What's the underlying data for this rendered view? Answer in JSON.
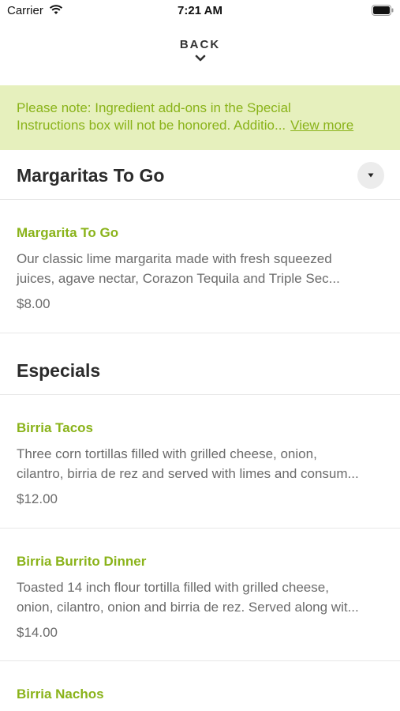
{
  "status_bar": {
    "carrier": "Carrier",
    "time": "7:21 AM"
  },
  "nav": {
    "back_label": "BACK"
  },
  "notice": {
    "line1": "Please note: Ingredient add-ons in the Special",
    "line2": "Instructions box will not be honored. Additio...",
    "link": "View more"
  },
  "sections": [
    {
      "title": "Margaritas To Go",
      "items": [
        {
          "name": "Margarita To Go",
          "desc1": "Our classic lime margarita made with fresh squeezed",
          "desc2": "juices, agave nectar, Corazon Tequila and Triple Sec...",
          "price": "$8.00"
        }
      ]
    },
    {
      "title": "Especials",
      "items": [
        {
          "name": "Birria Tacos",
          "desc1": "Three corn tortillas filled with grilled cheese, onion,",
          "desc2": "cilantro, birria de rez and served with limes and consum...",
          "price": "$12.00"
        },
        {
          "name": "Birria Burrito Dinner",
          "desc1": "Toasted 14 inch flour tortilla filled with grilled cheese,",
          "desc2": "onion, cilantro, onion and birria de rez. Served along wit...",
          "price": "$14.00"
        },
        {
          "name": "Birria Nachos"
        }
      ]
    }
  ],
  "colors": {
    "accent": "#8ab31a",
    "notice_bg": "#e6f0bd",
    "text_dark": "#2b2b2b",
    "text_muted": "#6b6b6b"
  }
}
